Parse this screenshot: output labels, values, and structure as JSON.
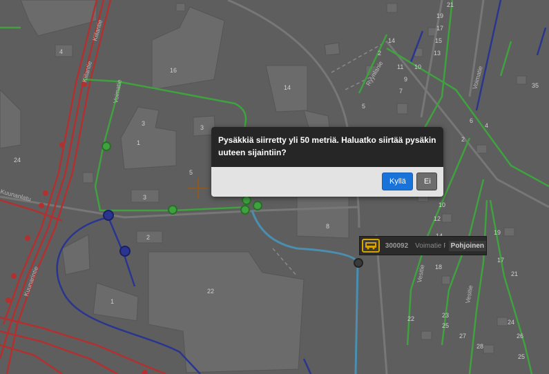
{
  "dialog": {
    "message": "Pysäkkiä siirretty yli 50 metriä. Haluatko siirtää pysäkin uuteen sijaintiin?",
    "yes_label": "Kyllä",
    "no_label": "Ei"
  },
  "stop_tooltip": {
    "icon": "bus-icon",
    "stop_id": "300092",
    "stop_name": "Voimatie P",
    "direction": "Pohjoinen"
  },
  "map": {
    "icons": [
      "crosshair-icon",
      "stop-marker-icon"
    ],
    "street_labels": [
      "Kiilantie",
      "Kiilantie",
      "Kuunanlatu",
      "Voimatie",
      "Voimatie",
      "Pohjoisentie",
      "Vesitie",
      "Vesitie",
      "Kuunarintie",
      "Ryynlanie"
    ],
    "building_numbers": [
      "4",
      "16",
      "14",
      "3",
      "3",
      "1",
      "5",
      "3",
      "2",
      "8",
      "22",
      "1",
      "24",
      "2",
      "14",
      "21",
      "19",
      "17",
      "15",
      "13",
      "11",
      "10",
      "9",
      "7",
      "5",
      "3",
      "8",
      "6",
      "4",
      "2",
      "35",
      "4",
      "2",
      "10",
      "12",
      "14",
      "16",
      "18",
      "19",
      "17",
      "21",
      "24",
      "26",
      "22",
      "23",
      "25",
      "27",
      "28",
      "25"
    ],
    "colors": {
      "background": "#5e5e5e",
      "tram_red": "#b23030",
      "bus_green": "#3fa23f",
      "metro_blue": "#2a3590",
      "edit_line": "#4a8fb0"
    }
  }
}
